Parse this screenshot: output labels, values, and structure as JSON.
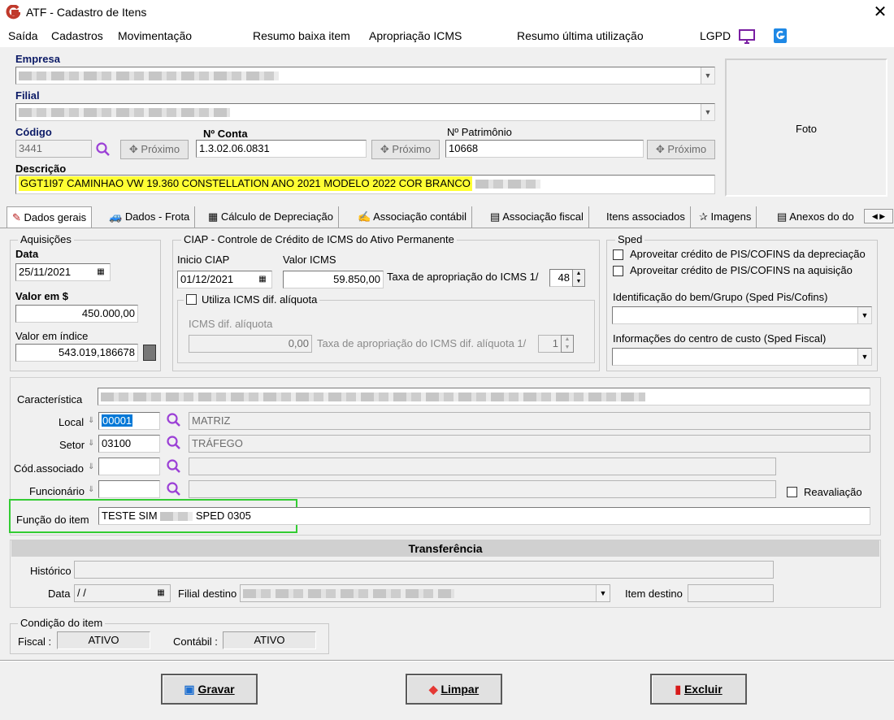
{
  "window": {
    "title": "ATF - Cadastro de Itens"
  },
  "menu": [
    "Saída",
    "Cadastros",
    "Movimentação",
    "Resumo baixa item",
    "Apropriação ICMS",
    "Resumo última utilização",
    "LGPD"
  ],
  "header": {
    "empresa_label": "Empresa",
    "filial_label": "Filial",
    "codigo_label": "Código",
    "codigo_value": "3441",
    "conta_label": "Nº Conta",
    "conta_value": "1.3.02.06.0831",
    "patrimonio_label": "Nº Patrimônio",
    "patrimonio_value": "10668",
    "proximo_label": "Próximo",
    "descricao_label": "Descrição",
    "descricao_value": "GGT1I97 CAMINHAO VW 19.360 CONSTELLATION ANO 2021 MODELO 2022 COR BRANCO",
    "foto_label": "Foto"
  },
  "tabs": [
    "Dados gerais",
    "Dados - Frota",
    "Cálculo de Depreciação",
    "Associação contábil",
    "Associação fiscal",
    "Itens associados",
    "Imagens",
    "Anexos do do"
  ],
  "aquisicoes": {
    "legend": "Aquisições",
    "data_label": "Data",
    "data_value": "25/11/2021",
    "valor_label": "Valor em $",
    "valor_value": "450.000,00",
    "indice_label": "Valor em índice",
    "indice_value": "543.019,186678"
  },
  "ciap": {
    "legend": "CIAP - Controle de Crédito de ICMS do Ativo Permanente",
    "inicio_label": "Inicio CIAP",
    "inicio_value": "01/12/2021",
    "valor_label": "Valor ICMS",
    "valor_value": "59.850,00",
    "taxa_label": "Taxa de apropriação do ICMS 1/",
    "taxa_value": "48",
    "utiliza_label": "Utiliza ICMS dif. alíquota",
    "dif_label": "ICMS dif. alíquota",
    "dif_value": "0,00",
    "taxa_dif_label": "Taxa de apropriação do ICMS dif. alíquota 1/",
    "taxa_dif_value": "1"
  },
  "sped": {
    "legend": "Sped",
    "pis_dep_label": "Aproveitar crédito de PIS/COFINS da depreciação",
    "pis_aq_label": "Aproveitar crédito de PIS/COFINS na aquisição",
    "ident_label": "Identificação do bem/Grupo (Sped Pis/Cofins)",
    "centro_label": "Informações do centro de custo (Sped Fiscal)"
  },
  "detalhes": {
    "caracteristica_label": "Característica",
    "local_label": "Local",
    "local_code": "00001",
    "local_name": "MATRIZ",
    "setor_label": "Setor",
    "setor_code": "03100",
    "setor_name": "TRÁFEGO",
    "cod_assoc_label": "Cód.associado",
    "funcionario_label": "Funcionário",
    "reavaliacao_label": "Reavaliação",
    "funcao_label": "Função do item",
    "funcao_value_a": "TESTE SIM",
    "funcao_value_b": "SPED 0305"
  },
  "transferencia": {
    "title": "Transferência",
    "historico_label": "Histórico",
    "data_label": "Data",
    "data_value": "/ /",
    "filial_label": "Filial destino",
    "item_label": "Item destino"
  },
  "condicao": {
    "legend": "Condição do item",
    "fiscal_label": "Fiscal :",
    "fiscal_value": "ATIVO",
    "contabil_label": "Contábil :",
    "contabil_value": "ATIVO"
  },
  "buttons": {
    "gravar": "Gravar",
    "limpar": "Limpar",
    "excluir": "Excluir"
  },
  "colors": {
    "accent": "#0b1a66",
    "highlight": "#ffff33",
    "focus_box": "#33cc33",
    "logo": "#c0392b"
  }
}
